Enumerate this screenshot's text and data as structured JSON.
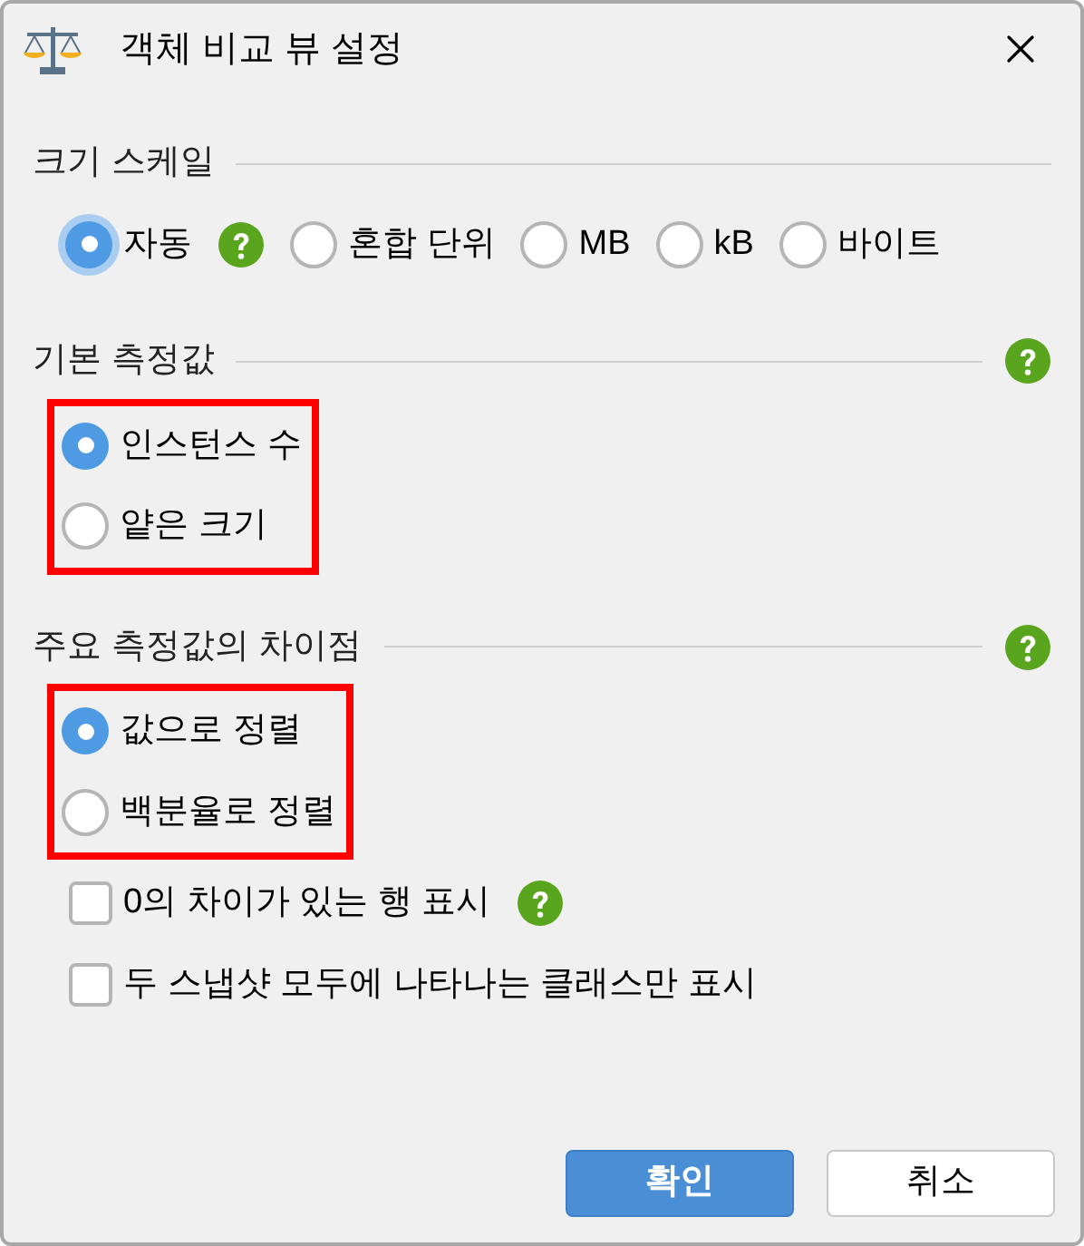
{
  "window": {
    "title": "객체 비교 뷰 설정"
  },
  "size_scale": {
    "heading": "크기 스케일",
    "options": [
      {
        "label": "자동",
        "selected": true,
        "focused": true,
        "help": true
      },
      {
        "label": "혼합 단위",
        "selected": false,
        "focused": false,
        "help": false
      },
      {
        "label": "MB",
        "selected": false,
        "focused": false,
        "help": false
      },
      {
        "label": "kB",
        "selected": false,
        "focused": false,
        "help": false
      },
      {
        "label": "바이트",
        "selected": false,
        "focused": false,
        "help": false
      }
    ]
  },
  "base_metric": {
    "heading": "기본 측정값",
    "help": true,
    "highlighted": true,
    "options": [
      {
        "label": "인스턴스 수",
        "selected": true
      },
      {
        "label": "얕은 크기",
        "selected": false
      }
    ]
  },
  "primary_difference": {
    "heading": "주요 측정값의 차이점",
    "help": true,
    "highlighted": true,
    "options": [
      {
        "label": "값으로 정렬",
        "selected": true
      },
      {
        "label": "백분율로 정렬",
        "selected": false
      }
    ],
    "checkboxes": [
      {
        "label": "0의 차이가 있는 행 표시",
        "checked": false,
        "help": true
      },
      {
        "label": "두 스냅샷 모두에 나타나는 클래스만 표시",
        "checked": false,
        "help": false
      }
    ]
  },
  "buttons": [
    {
      "label": "확인",
      "kind": "primary"
    },
    {
      "label": "취소",
      "kind": "secondary"
    }
  ]
}
